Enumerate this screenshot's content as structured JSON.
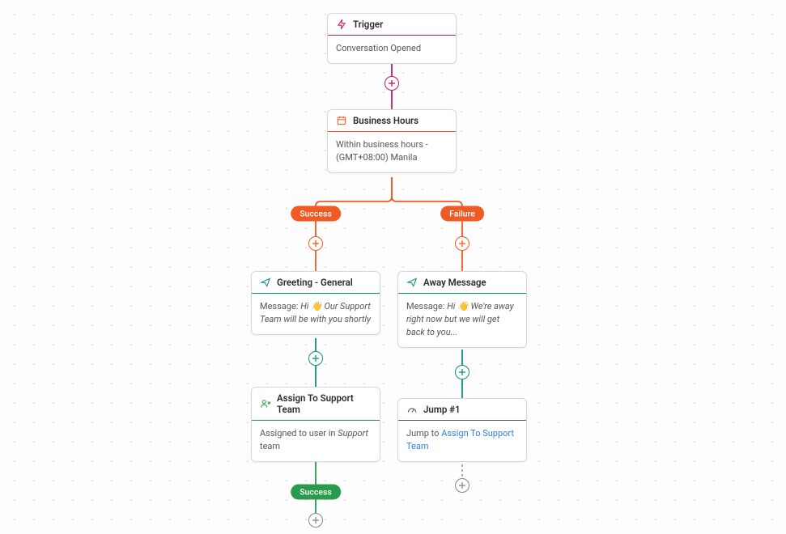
{
  "nodes": {
    "trigger": {
      "title": "Trigger",
      "body": "Conversation Opened"
    },
    "business_hours": {
      "title": "Business Hours",
      "body": "Within business hours - (GMT+08:00) Manila"
    },
    "greeting": {
      "title": "Greeting - General",
      "body_prefix": "Message: ",
      "body_italic": "Hi 👋 Our Support Team will be with you shortly"
    },
    "away": {
      "title": "Away Message",
      "body_prefix": "Message: ",
      "body_italic": "Hi 👋 We're away right now but we will get back to you..."
    },
    "assign": {
      "title": "Assign To Support Team",
      "body_prefix": "Assigned to user in ",
      "body_italic": "Support",
      "body_suffix": " team"
    },
    "jump": {
      "title": "Jump #1",
      "body_prefix": "Jump to ",
      "body_link": "Assign To Support Team"
    }
  },
  "branches": {
    "success": "Success",
    "failure": "Failure"
  },
  "end_pill": "Success"
}
